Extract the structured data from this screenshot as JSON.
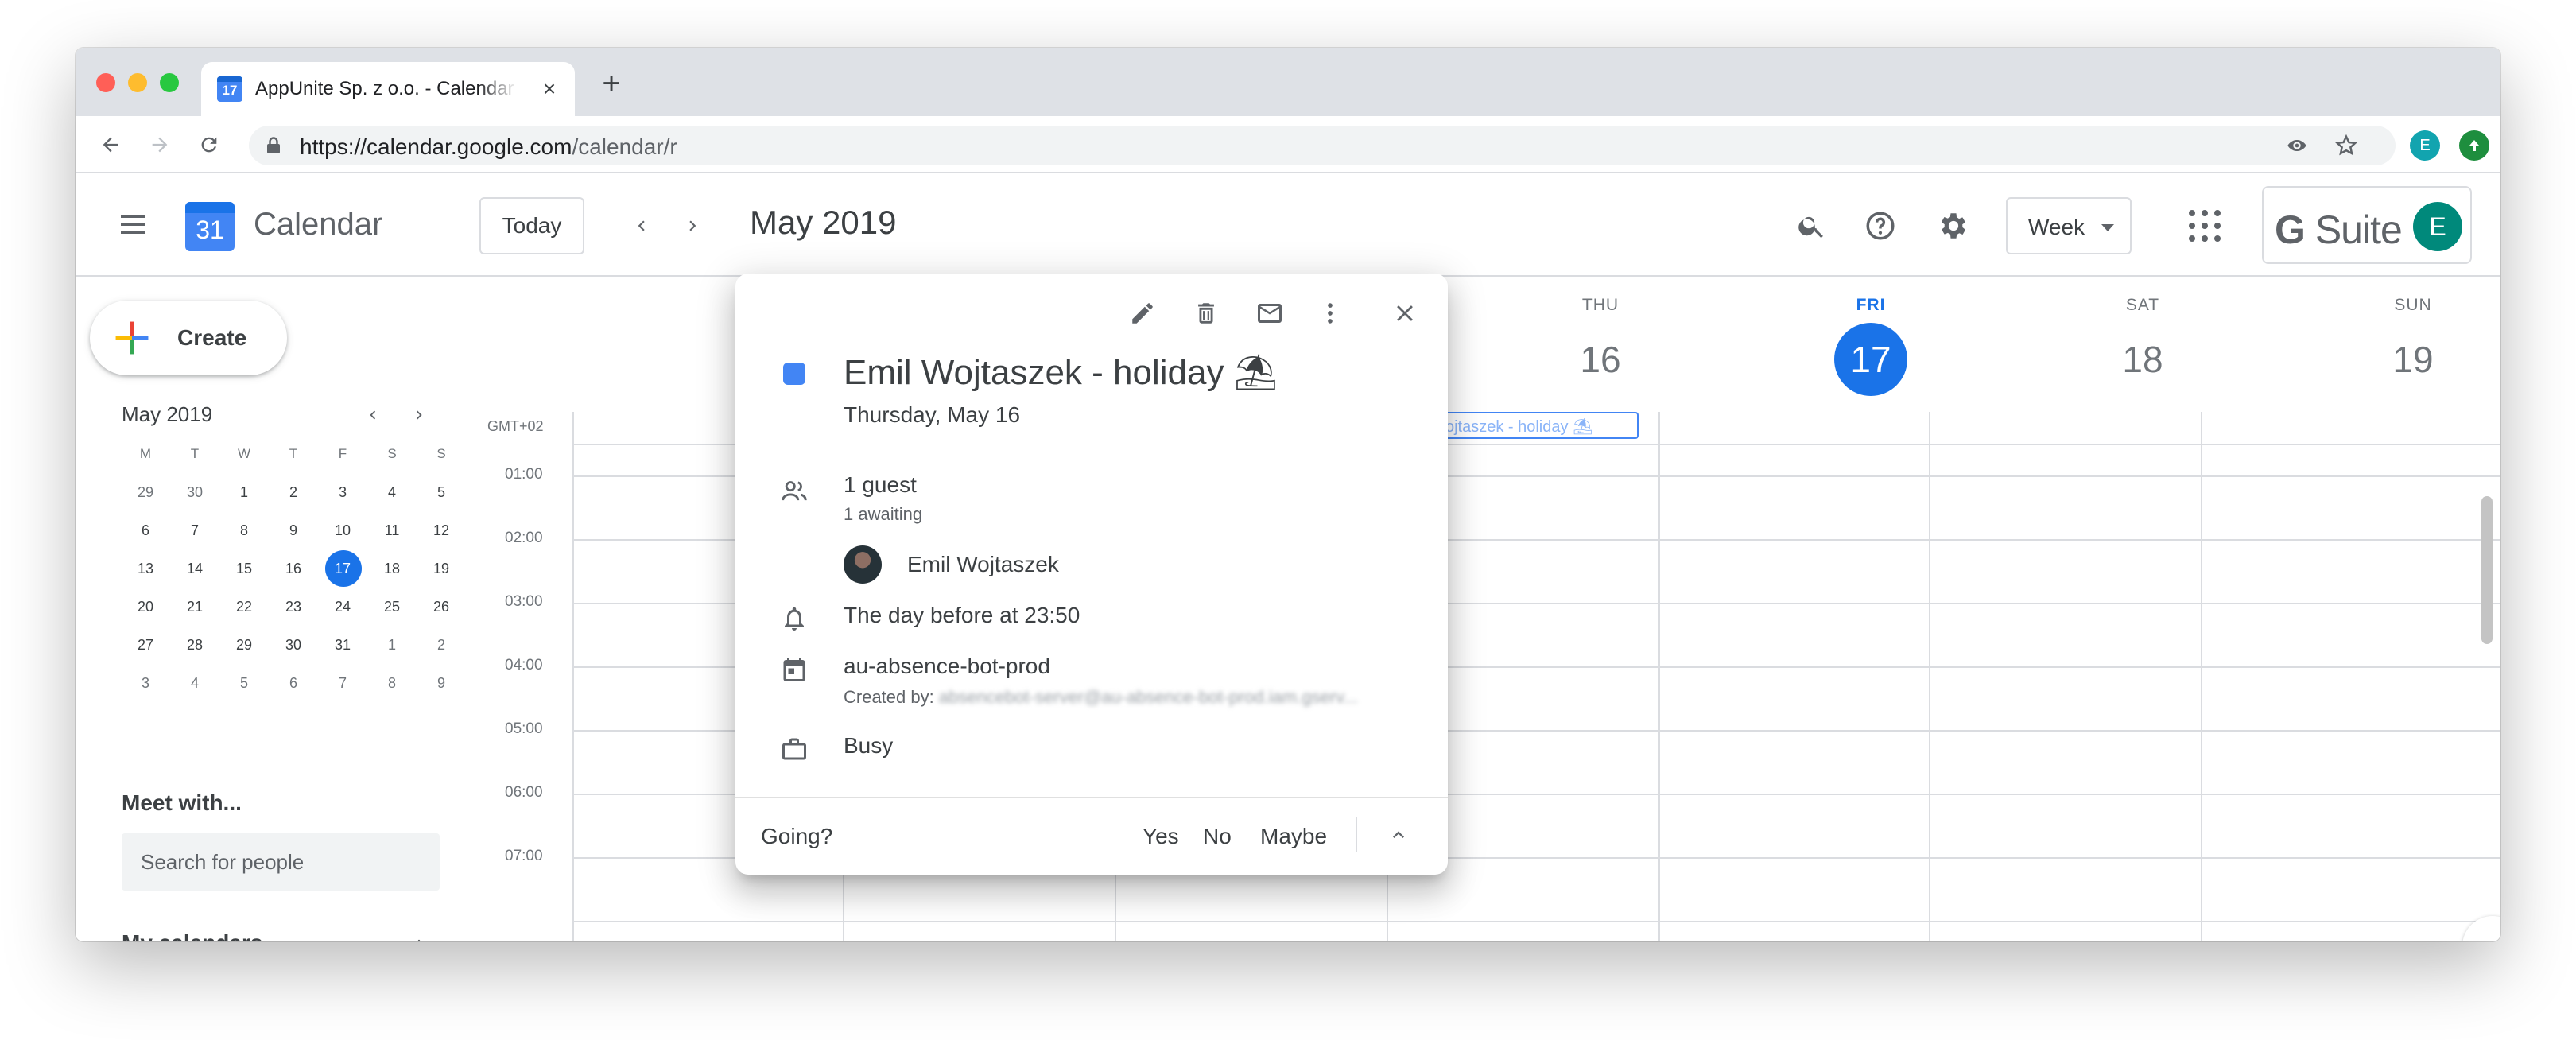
{
  "browser": {
    "tab_title": "AppUnite Sp. z o.o. - Calendar",
    "tab_favicon_text": "17",
    "url_host": "https://calendar.google.com",
    "url_path": "/calendar/r",
    "profile_initial": "E",
    "profile_color": "#12a4af",
    "update_color": "#1e8e3e"
  },
  "header": {
    "logo_day": "31",
    "app_name": "Calendar",
    "today_label": "Today",
    "month_title": "May 2019",
    "view_label": "Week",
    "gsuite_label": "Suite",
    "account_initial": "E"
  },
  "sidebar": {
    "create_label": "Create",
    "mini_month": "May 2019",
    "weekday_headers": [
      "M",
      "T",
      "W",
      "T",
      "F",
      "S",
      "S"
    ],
    "weeks": [
      [
        "29",
        "30",
        "1",
        "2",
        "3",
        "4",
        "5"
      ],
      [
        "6",
        "7",
        "8",
        "9",
        "10",
        "11",
        "12"
      ],
      [
        "13",
        "14",
        "15",
        "16",
        "17",
        "18",
        "19"
      ],
      [
        "20",
        "21",
        "22",
        "23",
        "24",
        "25",
        "26"
      ],
      [
        "27",
        "28",
        "29",
        "30",
        "31",
        "1",
        "2"
      ],
      [
        "3",
        "4",
        "5",
        "6",
        "7",
        "8",
        "9"
      ]
    ],
    "today_value": "17",
    "meet_title": "Meet with...",
    "people_placeholder": "Search for people",
    "my_calendars_title": "My calendars"
  },
  "week": {
    "days": [
      {
        "dow": "THU",
        "num": "16",
        "today": false
      },
      {
        "dow": "FRI",
        "num": "17",
        "today": true
      },
      {
        "dow": "SAT",
        "num": "18",
        "today": false
      },
      {
        "dow": "SUN",
        "num": "19",
        "today": false
      }
    ],
    "timezone": "GMT+02",
    "hours": [
      "01:00",
      "02:00",
      "03:00",
      "04:00",
      "05:00",
      "06:00",
      "07:00"
    ],
    "allday_event": "Emil Wojtaszek - holiday ⛱"
  },
  "popup": {
    "title": "Emil Wojtaszek - holiday ⛱",
    "date": "Thursday, May 16",
    "color": "#4285f4",
    "guests_count": "1 guest",
    "guests_status": "1 awaiting",
    "guest_name": "Emil Wojtaszek",
    "reminder": "The day before at 23:50",
    "calendar_name": "au-absence-bot-prod",
    "created_by_label": "Created by:",
    "created_by_value": "absencebot-server@au-absence-bot-prod.iam.gserv...",
    "availability": "Busy",
    "going_label": "Going?",
    "yes_label": "Yes",
    "no_label": "No",
    "maybe_label": "Maybe"
  }
}
